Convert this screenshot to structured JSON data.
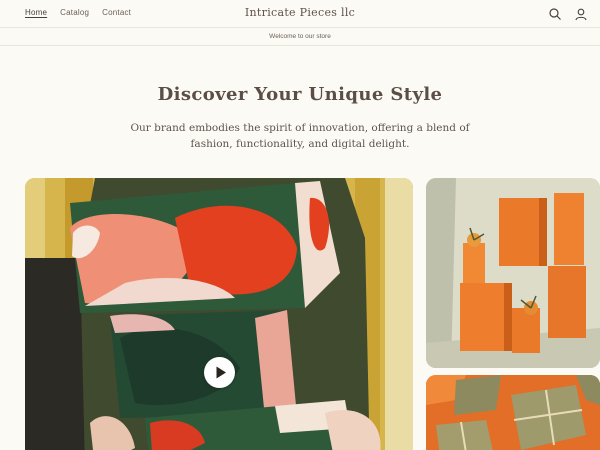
{
  "header": {
    "nav": [
      {
        "label": "Home",
        "active": true
      },
      {
        "label": "Catalog",
        "active": false
      },
      {
        "label": "Contact",
        "active": false
      }
    ],
    "brand": "Intricate Pieces llc",
    "icons": [
      "search-icon",
      "account-icon"
    ]
  },
  "announcement": "Welcome to our store",
  "hero": {
    "title": "Discover Your Unique Style",
    "subtitle": "Our brand embodies the spirit of innovation, offering a blend of fashion, functionality, and digital delight."
  },
  "colors": {
    "background": "#fcfaf4",
    "text": "#5a4e47",
    "accent_orange": "#e06e2c",
    "accent_green": "#2f4a33"
  }
}
